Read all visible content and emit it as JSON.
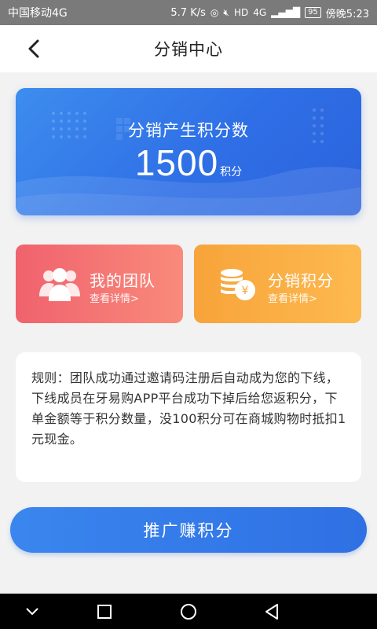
{
  "status_bar": {
    "carrier": "中国移动4G",
    "speed": "5.7 K/s",
    "network": "4G",
    "battery": "95",
    "time": "傍晚5:23"
  },
  "header": {
    "title": "分销中心",
    "back_icon": "chevron-left-icon"
  },
  "points_card": {
    "label": "分销产生积分数",
    "value": "1500",
    "unit": "积分"
  },
  "tiles": [
    {
      "title": "我的团队",
      "sub": "查看详情>",
      "icon": "team-icon",
      "color": "#f0626e"
    },
    {
      "title": "分销积分",
      "sub": "查看详情>",
      "icon": "coins-icon",
      "color": "#f7a43a"
    }
  ],
  "rules": {
    "text": "规则：团队成功通过邀请码注册后自动成为您的下线，下线成员在牙易购APP平台成功下掉后给您返积分，下单金额等于积分数量，没100积分可在商城购物时抵扣1元现金。"
  },
  "promote_button": {
    "label": "推广赚积分"
  },
  "colors": {
    "primary_blue": "#2f70e4",
    "team_red": "#f0626e",
    "points_orange": "#f7a43a"
  }
}
